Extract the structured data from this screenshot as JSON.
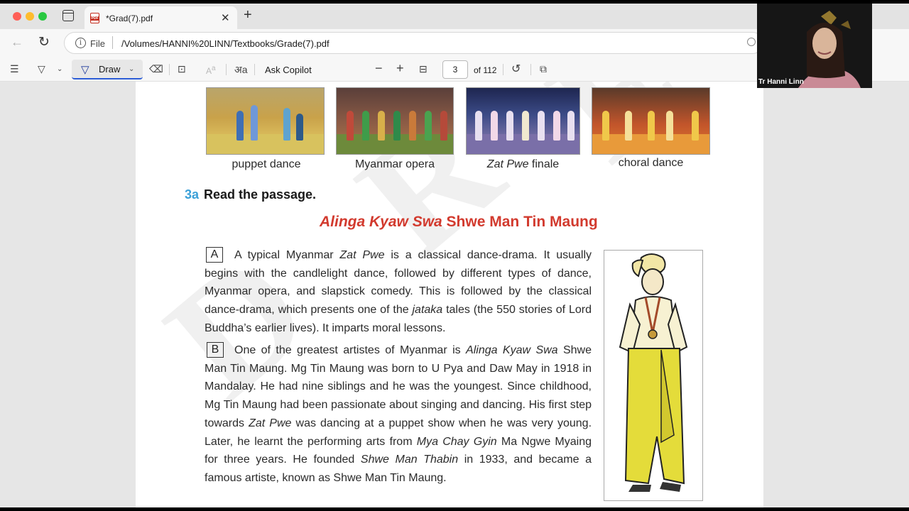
{
  "tab": {
    "title": "*Grad(7).pdf",
    "close": "✕",
    "new_tab": "+"
  },
  "address": {
    "scheme_label": "File",
    "url": "/Volumes/HANNI%20LINN/Textbooks/Grade(7).pdf"
  },
  "toolbar": {
    "draw_label": "Draw",
    "ask_copilot": "Ask Copilot",
    "zoom_out": "−",
    "zoom_in": "+",
    "page_current": "3",
    "page_total": "of 112"
  },
  "document": {
    "photos": [
      {
        "caption": "puppet dance"
      },
      {
        "caption": "Myanmar opera"
      },
      {
        "caption_italic": "Zat Pwe",
        "caption_rest": " finale"
      },
      {
        "caption": "choral dance"
      }
    ],
    "section_number": "3a",
    "section_title": "Read the passage.",
    "story_title_italic": "Alinga Kyaw Swa",
    "story_title_rest": " Shwe Man Tin Maung",
    "para_a_label": "A",
    "para_a": [
      "A typical Myanmar ",
      "Zat Pwe",
      " is a classical dance-drama. It usually begins with the candlelight dance, followed by different types of dance, Myanmar opera, and slapstick comedy. This is followed by the classical dance-drama, which presents one of the ",
      "jataka",
      " tales (the 550 stories of Lord Buddha’s earlier lives). It imparts moral lessons."
    ],
    "para_b_label": "B",
    "para_b": [
      "One of the greatest artistes of Myanmar is ",
      "Alinga Kyaw Swa",
      " Shwe Man Tin Maung. Mg Tin Maung was born to U Pya and Daw May in 1918 in Mandalay. He had nine siblings and he was the youngest. Since childhood, Mg Tin Maung had been passionate about singing and dancing. His first step towards ",
      "Zat Pwe",
      " was dancing at a puppet show when he was very young. Later, he learnt the performing arts from ",
      "Mya Chay Gyin",
      " Ma Ngwe Myaing for three years. He founded ",
      "Shwe Man Thabin",
      " in 1933, and became a famous artiste, known as Shwe Man Tin Maung."
    ]
  },
  "webcam": {
    "name": "Tr Hanni Linn"
  },
  "colors": {
    "accent_blue": "#2b5cd6",
    "title_red": "#d23a2e",
    "section_blue": "#3aa0d8"
  },
  "icons": [
    "window-icon",
    "pdf-file-icon",
    "back-arrow-icon",
    "refresh-icon",
    "info-icon",
    "zoom-lens-icon",
    "toc-icon",
    "highlight-icon",
    "draw-pen-icon",
    "eraser-icon",
    "textbox-icon",
    "text-format-icon",
    "read-aloud-icon",
    "fit-page-icon",
    "rotate-icon",
    "two-page-icon",
    "search-icon"
  ]
}
